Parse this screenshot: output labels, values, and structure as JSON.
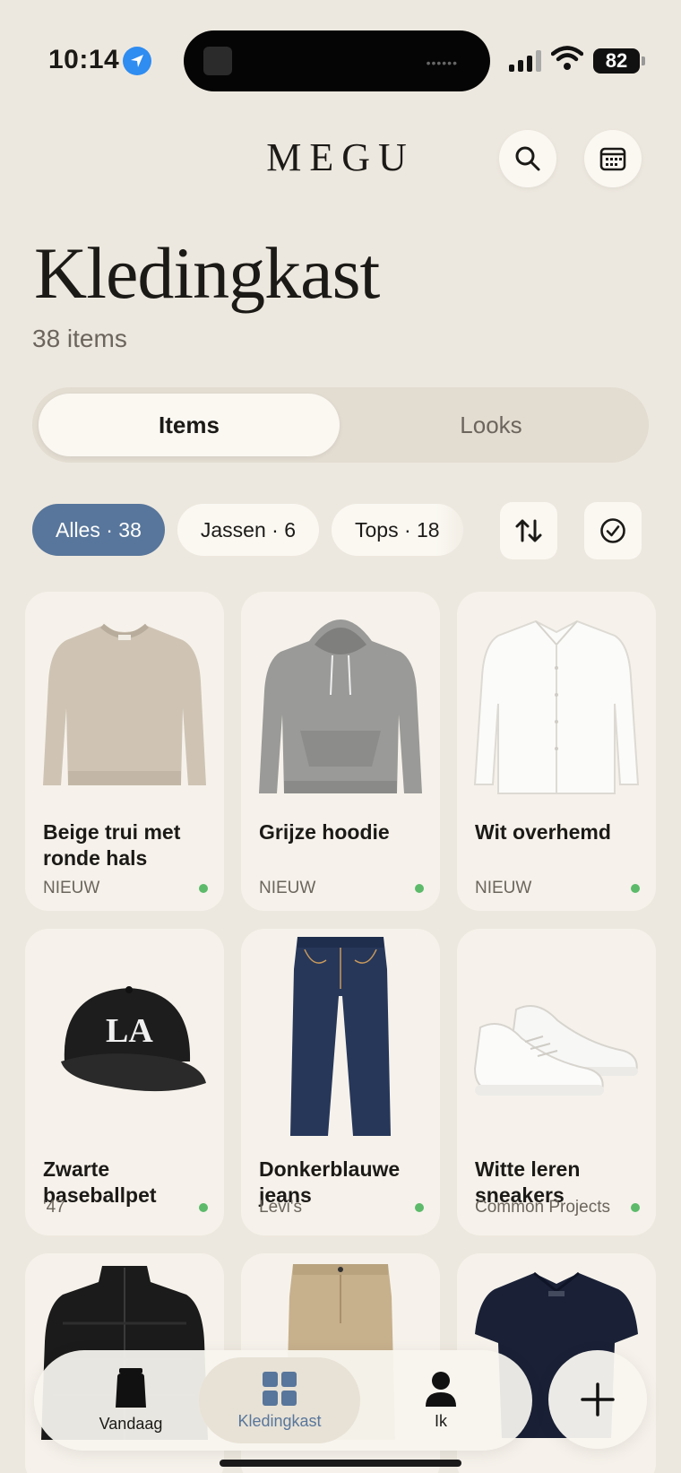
{
  "status": {
    "time": "10:14",
    "battery": "82"
  },
  "header": {
    "brand": "MEGU"
  },
  "page": {
    "title": "Kledingkast",
    "count": "38 items"
  },
  "tabs": [
    {
      "label": "Items",
      "active": true
    },
    {
      "label": "Looks",
      "active": false
    }
  ],
  "filters": [
    {
      "label": "Alles · 38",
      "active": true
    },
    {
      "label": "Jassen · 6",
      "active": false
    },
    {
      "label": "Tops · 18",
      "active": false
    }
  ],
  "items": [
    {
      "name": "Beige trui met ronde hals",
      "brand": "NIEUW"
    },
    {
      "name": "Grijze hoodie",
      "brand": "NIEUW"
    },
    {
      "name": "Wit overhemd",
      "brand": "NIEUW"
    },
    {
      "name": "Zwarte baseballpet",
      "brand": "'47"
    },
    {
      "name": "Donkerblauwe jeans",
      "brand": "Levi's"
    },
    {
      "name": "Witte leren sneakers",
      "brand": "Common Projects"
    }
  ],
  "nav": [
    {
      "label": "Vandaag",
      "icon": "jar-icon",
      "active": false
    },
    {
      "label": "Kledingkast",
      "icon": "grid-icon",
      "active": true
    },
    {
      "label": "Ik",
      "icon": "person-icon",
      "active": false
    }
  ],
  "colors": {
    "accent": "#58769b",
    "background": "#ede8df",
    "card": "#f6f2eb",
    "status_dot": "#5cba6a"
  }
}
